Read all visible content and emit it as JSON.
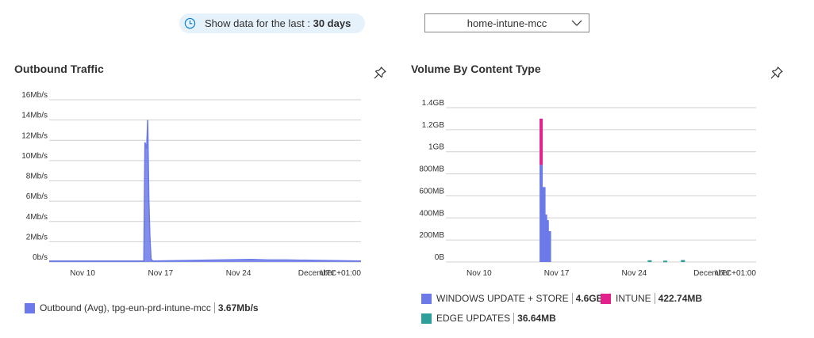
{
  "header": {
    "time_prefix": "Show data for the last :",
    "time_value": "30 days",
    "dropdown_value": "home-intune-mcc"
  },
  "colors": {
    "windows": "#6b7ae8",
    "intune": "#e3218c",
    "edge": "#2e9e9a",
    "outbound": "#6b7ae8",
    "pill_bg": "#e5f1fb"
  },
  "icons": [
    "clock-icon",
    "chevron-down-icon",
    "pin-icon"
  ],
  "outbound": {
    "title": "Outbound Traffic",
    "legend": {
      "label": "Outbound (Avg), tpg-eun-prd-intune-mcc",
      "value": "3.67Mb/s"
    }
  },
  "volume": {
    "title": "Volume By Content Type",
    "legend": [
      {
        "label": "WINDOWS UPDATE + STORE",
        "value": "4.6GB"
      },
      {
        "label": "INTUNE",
        "value": "422.74MB"
      },
      {
        "label": "EDGE UPDATES",
        "value": "36.64MB"
      }
    ]
  },
  "chart_data": [
    {
      "type": "area",
      "title": "Outbound Traffic",
      "y_ticks": [
        "16Mb/s",
        "14Mb/s",
        "12Mb/s",
        "10Mb/s",
        "8Mb/s",
        "6Mb/s",
        "4Mb/s",
        "2Mb/s",
        "0b/s"
      ],
      "x_ticks": [
        "Nov 10",
        "Nov 17",
        "Nov 24",
        "December"
      ],
      "timezone": "UTC+01:00",
      "y_unit": "Mb/s",
      "ylim": [
        0,
        16
      ],
      "xlim": [
        "Nov 7",
        "Dec 5"
      ],
      "grid": true,
      "series": [
        {
          "name": "Outbound (Avg), tpg-eun-prd-intune-mcc",
          "x": [
            "Nov 7",
            "Nov 15.5",
            "Nov 15.6",
            "Nov 15.75",
            "Nov 15.85",
            "Nov 15.95",
            "Nov 16.05",
            "Nov 16.15",
            "Nov 16.3",
            "Nov 25.2",
            "Nov 26.6",
            "Nov 28.3",
            "Dec 5"
          ],
          "values": [
            0.1,
            0.1,
            11.8,
            11.2,
            14.0,
            6.3,
            2.4,
            0.3,
            0.1,
            0.25,
            0.2,
            0.2,
            0.1
          ]
        }
      ]
    },
    {
      "type": "bar",
      "stacked": true,
      "title": "Volume By Content Type",
      "y_ticks": [
        "1.4GB",
        "1.2GB",
        "1GB",
        "800MB",
        "600MB",
        "400MB",
        "200MB",
        "0B"
      ],
      "x_ticks": [
        "Nov 10",
        "Nov 17",
        "Nov 24",
        "December"
      ],
      "timezone": "UTC+01:00",
      "y_unit": "MB",
      "ylim": [
        0,
        1400
      ],
      "xlim": [
        "Nov 7",
        "Dec 5"
      ],
      "grid": true,
      "categories": [
        "Nov 15.6",
        "Nov 15.85",
        "Nov 16.0",
        "Nov 16.15",
        "Nov 16.35",
        "Nov 25.4",
        "Nov 26.8",
        "Nov 28.4"
      ],
      "series": [
        {
          "name": "WINDOWS UPDATE + STORE",
          "values": [
            880,
            680,
            430,
            380,
            280,
            0,
            0,
            0
          ]
        },
        {
          "name": "INTUNE",
          "values": [
            420,
            0,
            0,
            0,
            0,
            0,
            0,
            0
          ]
        },
        {
          "name": "EDGE UPDATES",
          "values": [
            0,
            0,
            0,
            0,
            0,
            16,
            12,
            18
          ]
        }
      ]
    }
  ]
}
